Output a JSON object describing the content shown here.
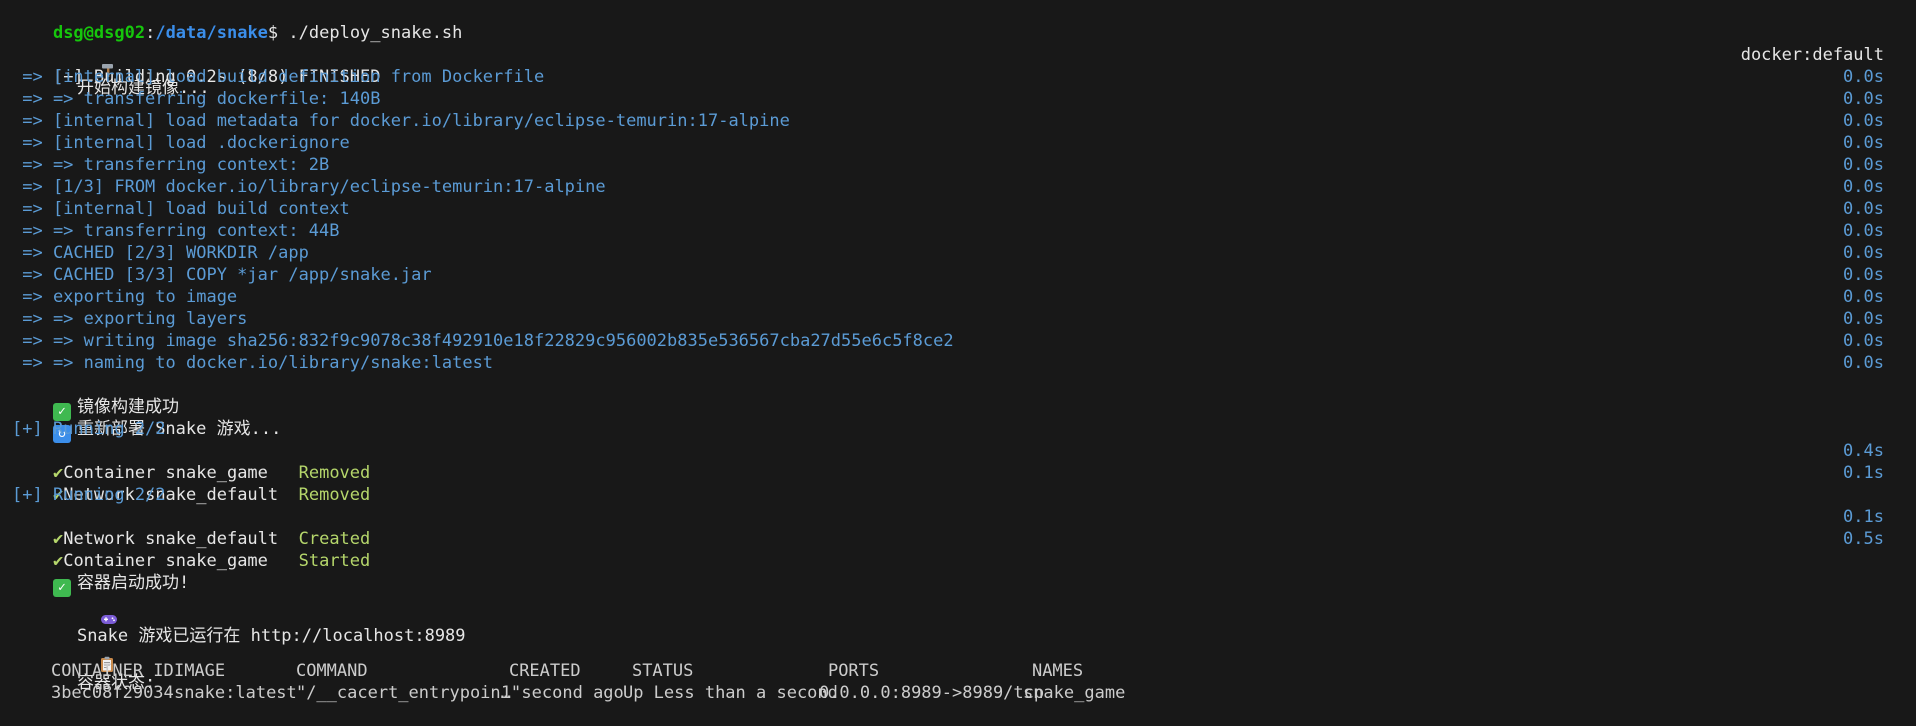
{
  "prompt": {
    "user_host": "dsg@dsg02",
    "path": "/data/snake",
    "symbol": "$",
    "command": " ./deploy_snake.sh"
  },
  "icons": {
    "hammer": "hammer-icon",
    "check": "check-mark-button-icon",
    "refresh": "refresh-icon",
    "game": "game-controller-icon",
    "clipboard": "clipboard-icon",
    "checkmark": "✔"
  },
  "colors": {
    "background": "#181818",
    "prompt_green": "#16c60c",
    "path_blue": "#3b8eea",
    "step_blue": "#5b9bd5",
    "status_green": "#b5d66b"
  },
  "msg_build_start": "开始构建镜像...",
  "build": {
    "header": "[+] Building 0.2s (8/8) FINISHED",
    "header_right": "docker:default",
    "steps": [
      {
        "text": " => [internal] load build definition from Dockerfile",
        "time": "0.0s"
      },
      {
        "text": " => => transferring dockerfile: 140B",
        "time": "0.0s"
      },
      {
        "text": " => [internal] load metadata for docker.io/library/eclipse-temurin:17-alpine",
        "time": "0.0s"
      },
      {
        "text": " => [internal] load .dockerignore",
        "time": "0.0s"
      },
      {
        "text": " => => transferring context: 2B",
        "time": "0.0s"
      },
      {
        "text": " => [1/3] FROM docker.io/library/eclipse-temurin:17-alpine",
        "time": "0.0s"
      },
      {
        "text": " => [internal] load build context",
        "time": "0.0s"
      },
      {
        "text": " => => transferring context: 44B",
        "time": "0.0s"
      },
      {
        "text": " => CACHED [2/3] WORKDIR /app",
        "time": "0.0s"
      },
      {
        "text": " => CACHED [3/3] COPY *jar /app/snake.jar",
        "time": "0.0s"
      },
      {
        "text": " => exporting to image",
        "time": "0.0s"
      },
      {
        "text": " => => exporting layers",
        "time": "0.0s"
      },
      {
        "text": " => => writing image sha256:832f9c9078c38f492910e18f22829c956002b835e536567cba27d55e6c5f8ce2",
        "time": "0.0s"
      },
      {
        "text": " => => naming to docker.io/library/snake:latest",
        "time": "0.0s"
      }
    ]
  },
  "msg_build_success": "镜像构建成功",
  "msg_redeploy": "重新部署 Snake 游戏...",
  "running_1": {
    "header": "[+] Running 2/2",
    "items": [
      {
        "name": "Container snake_game   ",
        "status": "Removed",
        "time": "0.4s"
      },
      {
        "name": "Network snake_default  ",
        "status": "Removed",
        "time": "0.1s"
      }
    ]
  },
  "running_2": {
    "header": "[+] Running 2/2",
    "items": [
      {
        "name": "Network snake_default  ",
        "status": "Created",
        "time": "0.1s"
      },
      {
        "name": "Container snake_game   ",
        "status": "Started",
        "time": "0.5s"
      }
    ]
  },
  "msg_container_started": "容器启动成功!",
  "msg_running_at": "Snake 游戏已运行在 http://localhost:8989",
  "msg_container_status": "容器状态:",
  "ps_table": {
    "headers": [
      "CONTAINER ID",
      "IMAGE",
      "COMMAND",
      "CREATED",
      "STATUS",
      "PORTS",
      "NAMES"
    ],
    "rows": [
      [
        "3bec08f29034",
        "snake:latest",
        "\"/__cacert_entrypoin…\"",
        "1 second ago",
        "Up Less than a second",
        "0.0.0.0:8989->8989/tcp",
        "snake_game"
      ]
    ]
  }
}
